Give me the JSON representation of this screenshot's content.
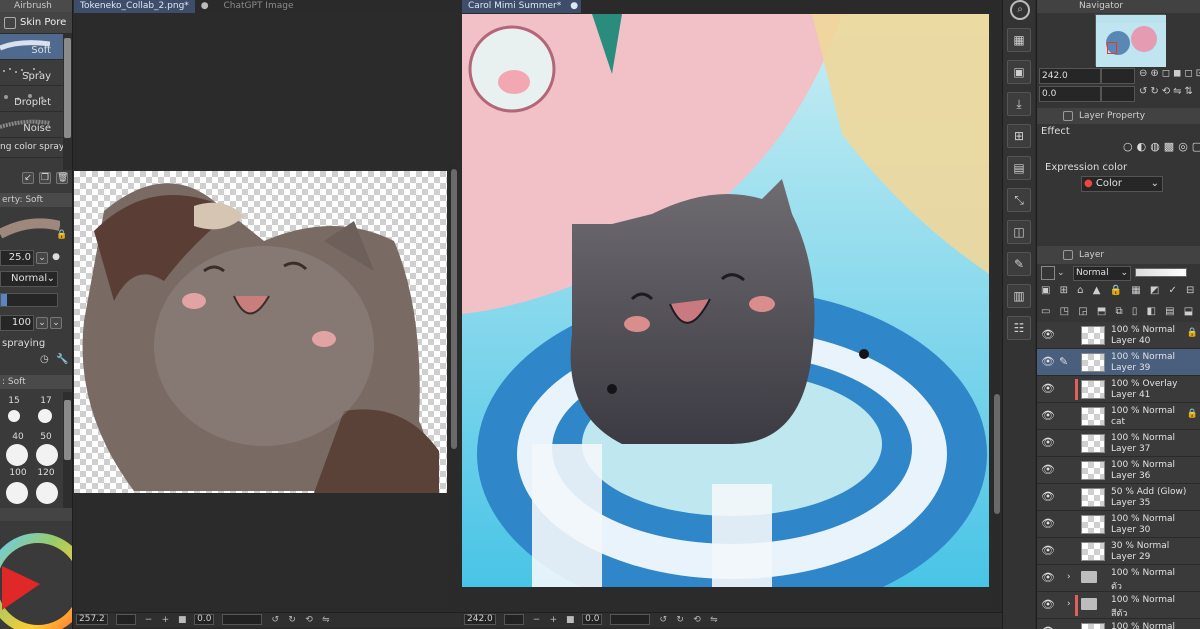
{
  "left_palette": {
    "group_tab": "Airbrush",
    "subtool_tab": "Skin Pore",
    "brushes": [
      "Soft",
      "Spray",
      "Droplet",
      "Noise",
      "ng color spray"
    ],
    "property_header": "erty: Soft",
    "size_value": "25.0",
    "blend_mode": "Normal",
    "opacity_value": "100",
    "spraying_label": "spraying",
    "brush_size_header": ": Soft",
    "brush_sizes": [
      "15",
      "17",
      "40",
      "50",
      "100",
      "120"
    ],
    "icons": [
      "add-subtool-icon",
      "copy-subtool-icon",
      "delete-subtool-icon",
      "lock-icon",
      "wrench-icon"
    ]
  },
  "canvas_left": {
    "tabs": [
      "Tokeneko_Collab_2.png*",
      "ChatGPT Image"
    ],
    "active_tab": 0,
    "zoom": "257.2",
    "rotation": "0.0"
  },
  "canvas_right": {
    "tab": "Carol Mimi Summer*",
    "zoom": "242.0",
    "rotation": "0.0"
  },
  "navigator": {
    "title": "Navigator",
    "zoom": "242.0",
    "angle": "0.0"
  },
  "layer_property": {
    "title": "Layer Property",
    "effect_label": "Effect",
    "expression_label": "Expression color",
    "expression_value": "Color"
  },
  "layer_panel": {
    "title": "Layer",
    "blend_mode": "Normal",
    "layers": [
      {
        "mode": "100 % Normal",
        "name": "Layer 40",
        "selected": false,
        "flag": false,
        "folder": false,
        "lock": true
      },
      {
        "mode": "100 % Normal",
        "name": "Layer 39",
        "selected": true,
        "flag": false,
        "folder": false,
        "lock": false
      },
      {
        "mode": "100 % Overlay",
        "name": "Layer 41",
        "selected": false,
        "flag": true,
        "folder": false,
        "lock": false
      },
      {
        "mode": "100 % Normal",
        "name": "cat",
        "selected": false,
        "flag": false,
        "folder": false,
        "lock": true
      },
      {
        "mode": "100 % Normal",
        "name": "Layer 37",
        "selected": false,
        "flag": false,
        "folder": false,
        "lock": false
      },
      {
        "mode": "100 % Normal",
        "name": "Layer 36",
        "selected": false,
        "flag": false,
        "folder": false,
        "lock": false
      },
      {
        "mode": "50 % Add (Glow)",
        "name": "Layer 35",
        "selected": false,
        "flag": false,
        "folder": false,
        "lock": false
      },
      {
        "mode": "100 % Normal",
        "name": "Layer 30",
        "selected": false,
        "flag": false,
        "folder": false,
        "lock": false
      },
      {
        "mode": "30 % Normal",
        "name": "Layer 29",
        "selected": false,
        "flag": false,
        "folder": false,
        "lock": false
      },
      {
        "mode": "100 % Normal",
        "name": "ตัว",
        "selected": false,
        "flag": false,
        "folder": true,
        "lock": false
      },
      {
        "mode": "100 % Normal",
        "name": "สีตัว",
        "selected": false,
        "flag": true,
        "folder": true,
        "lock": false
      },
      {
        "mode": "100 % Normal",
        "name": "",
        "selected": false,
        "flag": false,
        "folder": false,
        "lock": false
      }
    ]
  },
  "colors": {
    "accent_selected": "#4a5e7e",
    "panel_bg": "#353535",
    "flag_red": "#e06060"
  }
}
